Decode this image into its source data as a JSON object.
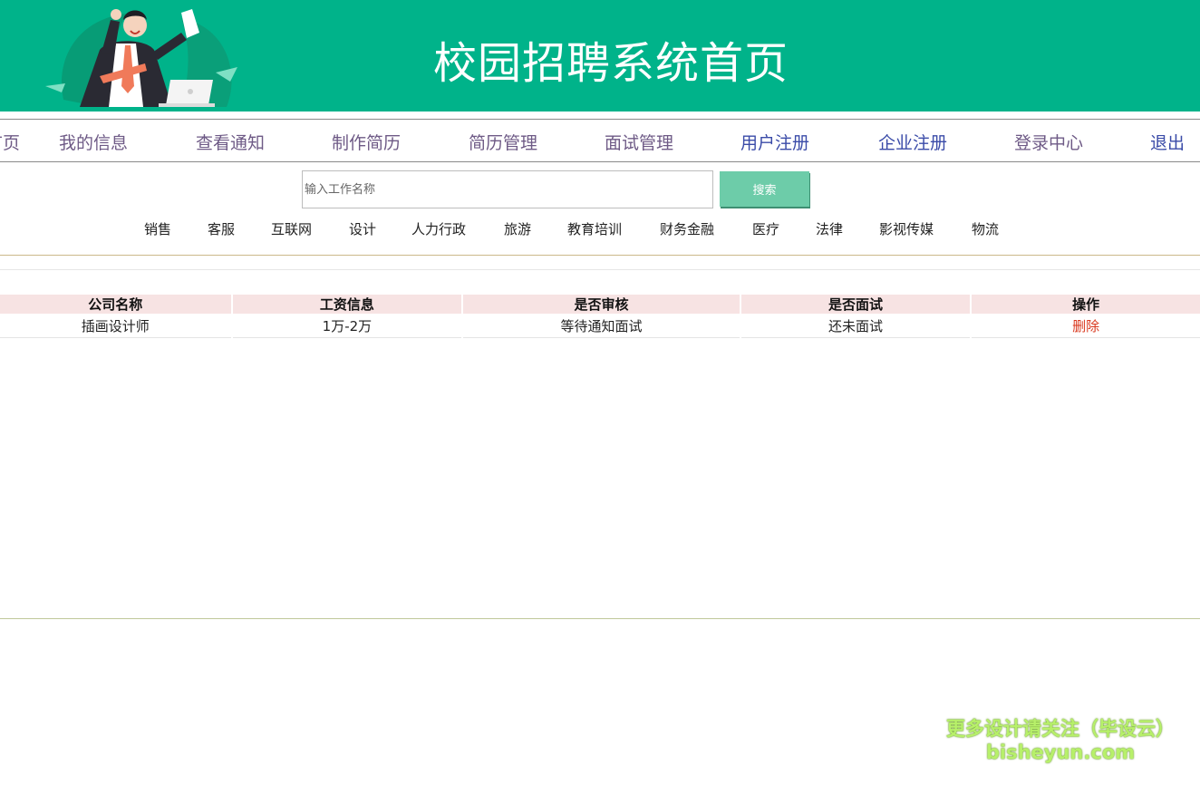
{
  "header": {
    "title": "校园招聘系统首页",
    "bg_color": "#00b38a"
  },
  "nav": {
    "items": [
      {
        "label": "首页"
      },
      {
        "label": "我的信息"
      },
      {
        "label": "查看通知"
      },
      {
        "label": "制作简历"
      },
      {
        "label": "简历管理"
      },
      {
        "label": "面试管理"
      },
      {
        "label": "用户注册"
      },
      {
        "label": "企业注册"
      },
      {
        "label": "登录中心"
      },
      {
        "label": "退出"
      }
    ]
  },
  "search": {
    "placeholder": "输入工作名称",
    "button_label": "搜索",
    "button_color": "#6dcca9"
  },
  "categories": [
    "销售",
    "客服",
    "互联网",
    "设计",
    "人力行政",
    "旅游",
    "教育培训",
    "财务金融",
    "医疗",
    "法律",
    "影视传媒",
    "物流"
  ],
  "table": {
    "headers": [
      "公司名称",
      "工资信息",
      "是否审核",
      "是否面试",
      "操作"
    ],
    "rows": [
      {
        "company": "插画设计师",
        "salary": "1万-2万",
        "review": "等待通知面试",
        "interview": "还未面试",
        "action": "删除"
      }
    ],
    "header_bg": "#f7e3e3",
    "action_color": "#d9381e"
  },
  "watermark": {
    "line1": "更多设计请关注（毕设云）",
    "line2": "bisheyun.com"
  }
}
